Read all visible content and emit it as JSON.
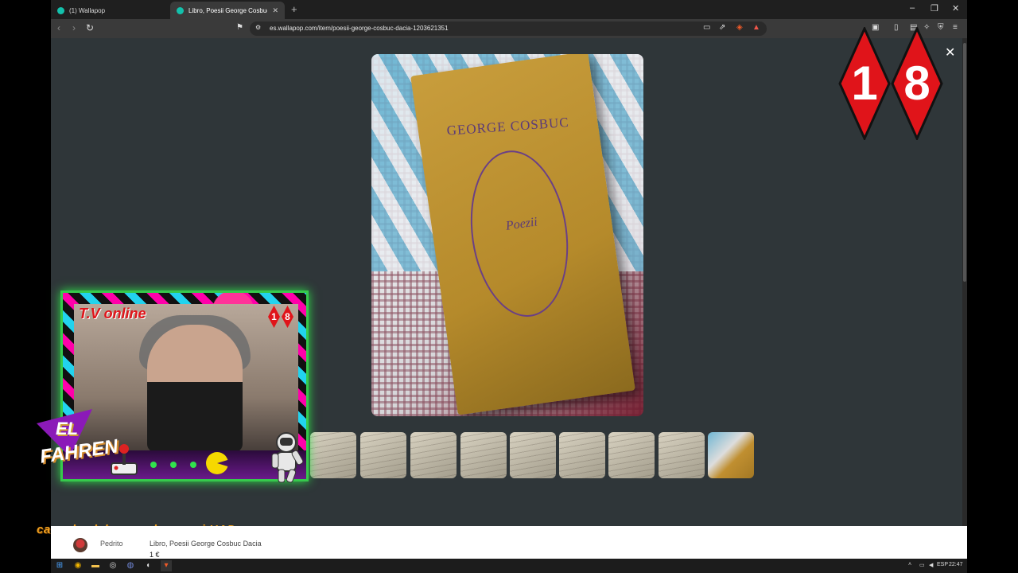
{
  "tabs": [
    {
      "label": "(1) Wallapop"
    },
    {
      "label": "Libro, Poesii George Cosbuc Dacia"
    }
  ],
  "address_bar": {
    "url": "es.wallapop.com/item/poesii-george-cosbuc-dacia-1203621351"
  },
  "image_viewer": {
    "book_title": "GEORGE COSBUC",
    "book_subtitle": "Poezii"
  },
  "overlay": {
    "badge_digits": [
      "1",
      "8"
    ],
    "tv_label": "T.V online",
    "logo_line1": "EL",
    "logo_line2": "FAHREN",
    "ticker": "casa, las labores y luego, si HAD"
  },
  "item_info": {
    "seller": "Pedrito",
    "title": "Libro, Poesii George Cosbuc Dacia",
    "price": "1 €"
  },
  "taskbar": {
    "language": "ESP",
    "time": "22:47"
  },
  "thumbnail_count": 9
}
